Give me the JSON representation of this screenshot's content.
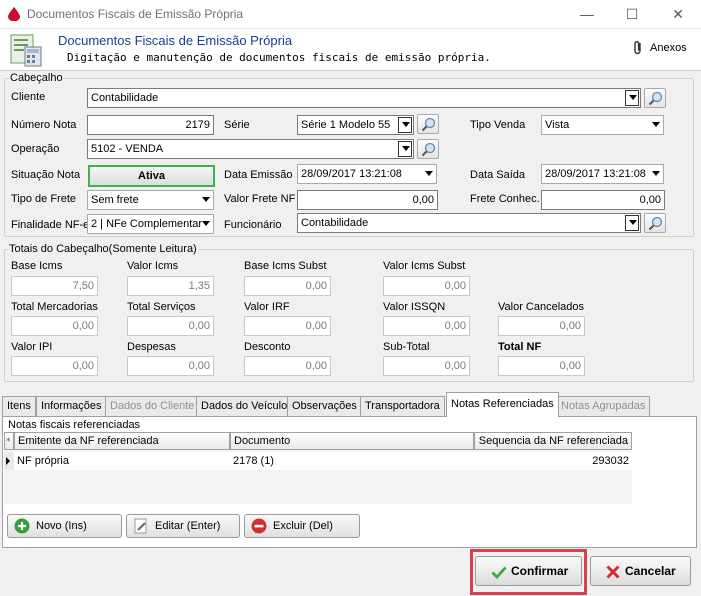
{
  "window": {
    "title": "Documentos Fiscais de Emissão Própria",
    "minimize_glyph": "—",
    "maximize_glyph": "☐",
    "close_glyph": "✕"
  },
  "header": {
    "title": "Documentos Fiscais de Emissão Própria",
    "subtitle": "Digitação e manutenção de documentos fiscais de emissão própria.",
    "anexos_label": "Anexos",
    "icon": "document-calculator-icon"
  },
  "cabecalho": {
    "group_label": "Cabeçalho",
    "cliente_label": "Cliente",
    "cliente_value": "Contabilidade",
    "numero_nota_label": "Número Nota",
    "numero_nota_value": "2179",
    "serie_label": "Série",
    "serie_value": "Série 1 Modelo 55",
    "tipo_venda_label": "Tipo Venda",
    "tipo_venda_value": "Vista",
    "operacao_label": "Operação",
    "operacao_value": "5102  - VENDA",
    "situacao_label": "Situação Nota",
    "situacao_value": "Ativa",
    "data_emissao_label": "Data Emissão",
    "data_emissao_value": "28/09/2017 13:21:08",
    "data_saida_label": "Data Saída",
    "data_saida_value": "28/09/2017 13:21:08",
    "tipo_frete_label": "Tipo de Frete",
    "tipo_frete_value": "Sem frete",
    "valor_frete_label": "Valor Frete NF",
    "valor_frete_value": "0,00",
    "frete_conhec_label": "Frete Conhec.",
    "frete_conhec_value": "0,00",
    "finalidade_label": "Finalidade NF-e",
    "finalidade_value": "2 | NFe Complementar",
    "funcionario_label": "Funcionário",
    "funcionario_value": "Contabilidade"
  },
  "totais": {
    "group_label": "Totais do Cabeçalho(Somente Leitura)",
    "base_icms_label": "Base Icms",
    "base_icms_value": "7,50",
    "valor_icms_label": "Valor Icms",
    "valor_icms_value": "1,35",
    "base_icms_subst_label": "Base Icms Subst",
    "base_icms_subst_value": "0,00",
    "valor_icms_subst_label": "Valor Icms Subst",
    "valor_icms_subst_value": "0,00",
    "total_mercadorias_label": "Total Mercadorias",
    "total_mercadorias_value": "0,00",
    "total_servicos_label": "Total Serviços",
    "total_servicos_value": "0,00",
    "valor_irf_label": "Valor  IRF",
    "valor_irf_value": "0,00",
    "valor_issqn_label": "Valor ISSQN",
    "valor_issqn_value": "0,00",
    "valor_cancelados_label": "Valor Cancelados",
    "valor_cancelados_value": "0,00",
    "valor_ipi_label": "Valor IPI",
    "valor_ipi_value": "0,00",
    "despesas_label": "Despesas",
    "despesas_value": "0,00",
    "desconto_label": "Desconto",
    "desconto_value": "0,00",
    "subtotal_label": "Sub-Total",
    "subtotal_value": "0,00",
    "total_nf_label": "Total NF",
    "total_nf_value": "0,00"
  },
  "tabs": [
    {
      "label": "Itens"
    },
    {
      "label": "Informações"
    },
    {
      "label": "Dados do Cliente"
    },
    {
      "label": "Dados do Veículo"
    },
    {
      "label": "Observações"
    },
    {
      "label": "Transportadora"
    },
    {
      "label": "Notas Referenciadas"
    },
    {
      "label": "Notas Agrupadas"
    }
  ],
  "notas_ref": {
    "group_label": "Notas fiscais referenciadas",
    "columns": [
      "Emitente da NF referenciada",
      "Documento",
      "Sequencia da NF referenciada"
    ],
    "rows": [
      {
        "emitente": "NF própria",
        "documento": "2178 (1)",
        "sequencia": "293032"
      }
    ]
  },
  "actions": {
    "novo": "Novo (Ins)",
    "editar": "Editar (Enter)",
    "excluir": "Excluir (Del)",
    "confirmar": "Confirmar",
    "cancelar": "Cancelar"
  },
  "colors": {
    "header_title": "#1a3d8f",
    "active_border": "#3fb34f",
    "highlight": "#d9404f"
  }
}
